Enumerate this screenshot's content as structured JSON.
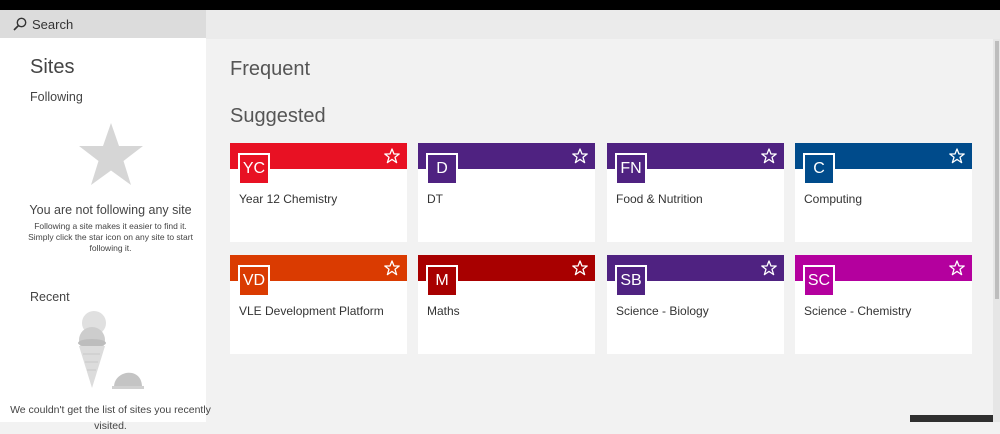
{
  "search": {
    "label": "Search"
  },
  "sidebar": {
    "title": "Sites",
    "following": {
      "label": "Following",
      "empty_title": "You are not following any site",
      "empty_text": "Following a site makes it easier to find it. Simply click the star icon on any site to start following it."
    },
    "recent": {
      "label": "Recent",
      "message": "We couldn't get the list of sites you recently visited."
    }
  },
  "main": {
    "frequent_heading": "Frequent",
    "suggested_heading": "Suggested",
    "tiles": [
      {
        "initials": "YC",
        "name": "Year 12 Chemistry",
        "color": "#e81123"
      },
      {
        "initials": "D",
        "name": "DT",
        "color": "#4f2281"
      },
      {
        "initials": "FN",
        "name": "Food & Nutrition",
        "color": "#4f2281"
      },
      {
        "initials": "C",
        "name": "Computing",
        "color": "#004b8b"
      },
      {
        "initials": "VD",
        "name": "VLE Development Platform",
        "color": "#da3b01"
      },
      {
        "initials": "M",
        "name": "Maths",
        "color": "#a80000"
      },
      {
        "initials": "SB",
        "name": "Science - Biology",
        "color": "#4f2281"
      },
      {
        "initials": "SC",
        "name": "Science - Chemistry",
        "color": "#b4009e"
      }
    ]
  },
  "icons": {
    "search": "search-icon",
    "follow": "star-outline-icon",
    "empty_following": "star-icon",
    "empty_recent": "ice-cream-icon"
  }
}
